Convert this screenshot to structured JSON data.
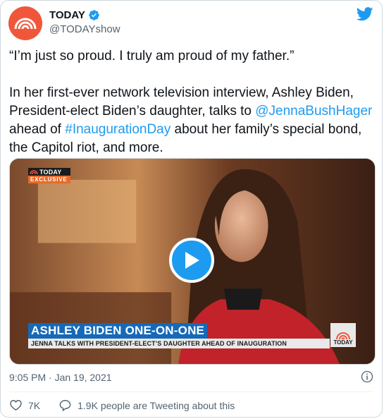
{
  "account": {
    "display_name": "TODAY",
    "handle": "@TODAYshow",
    "verified": true,
    "brand_color": "#f0563a"
  },
  "tweet": {
    "quote": "“I’m just so proud. I truly am proud of my father.”",
    "body_part1": "In her first-ever network television interview, Ashley Biden, President-elect Biden’s daughter, talks to ",
    "mention": "@JennaBushHager",
    "body_part2": " ahead of ",
    "hashtag": "#InaugurationDay",
    "body_part3": " about her family’s special bond, the Capitol riot, and more."
  },
  "media": {
    "badge_brand": "TODAY",
    "badge_label": "EXCLUSIVE",
    "lower_third_title": "ASHLEY BIDEN ONE-ON-ONE",
    "lower_third_subtitle": "JENNA TALKS WITH PRESIDENT-ELECT’S DAUGHTER AHEAD OF INAUGURATION",
    "corner_logo": "TODAY",
    "play_icon": "play-icon"
  },
  "meta": {
    "timestamp": "9:05 PM · Jan 19, 2021"
  },
  "actions": {
    "likes": "7K",
    "discussion": "1.9K people are Tweeting about this"
  },
  "colors": {
    "link": "#1d9bf0",
    "secondary_text": "#536471",
    "lower_third_blue": "#1569b8"
  }
}
